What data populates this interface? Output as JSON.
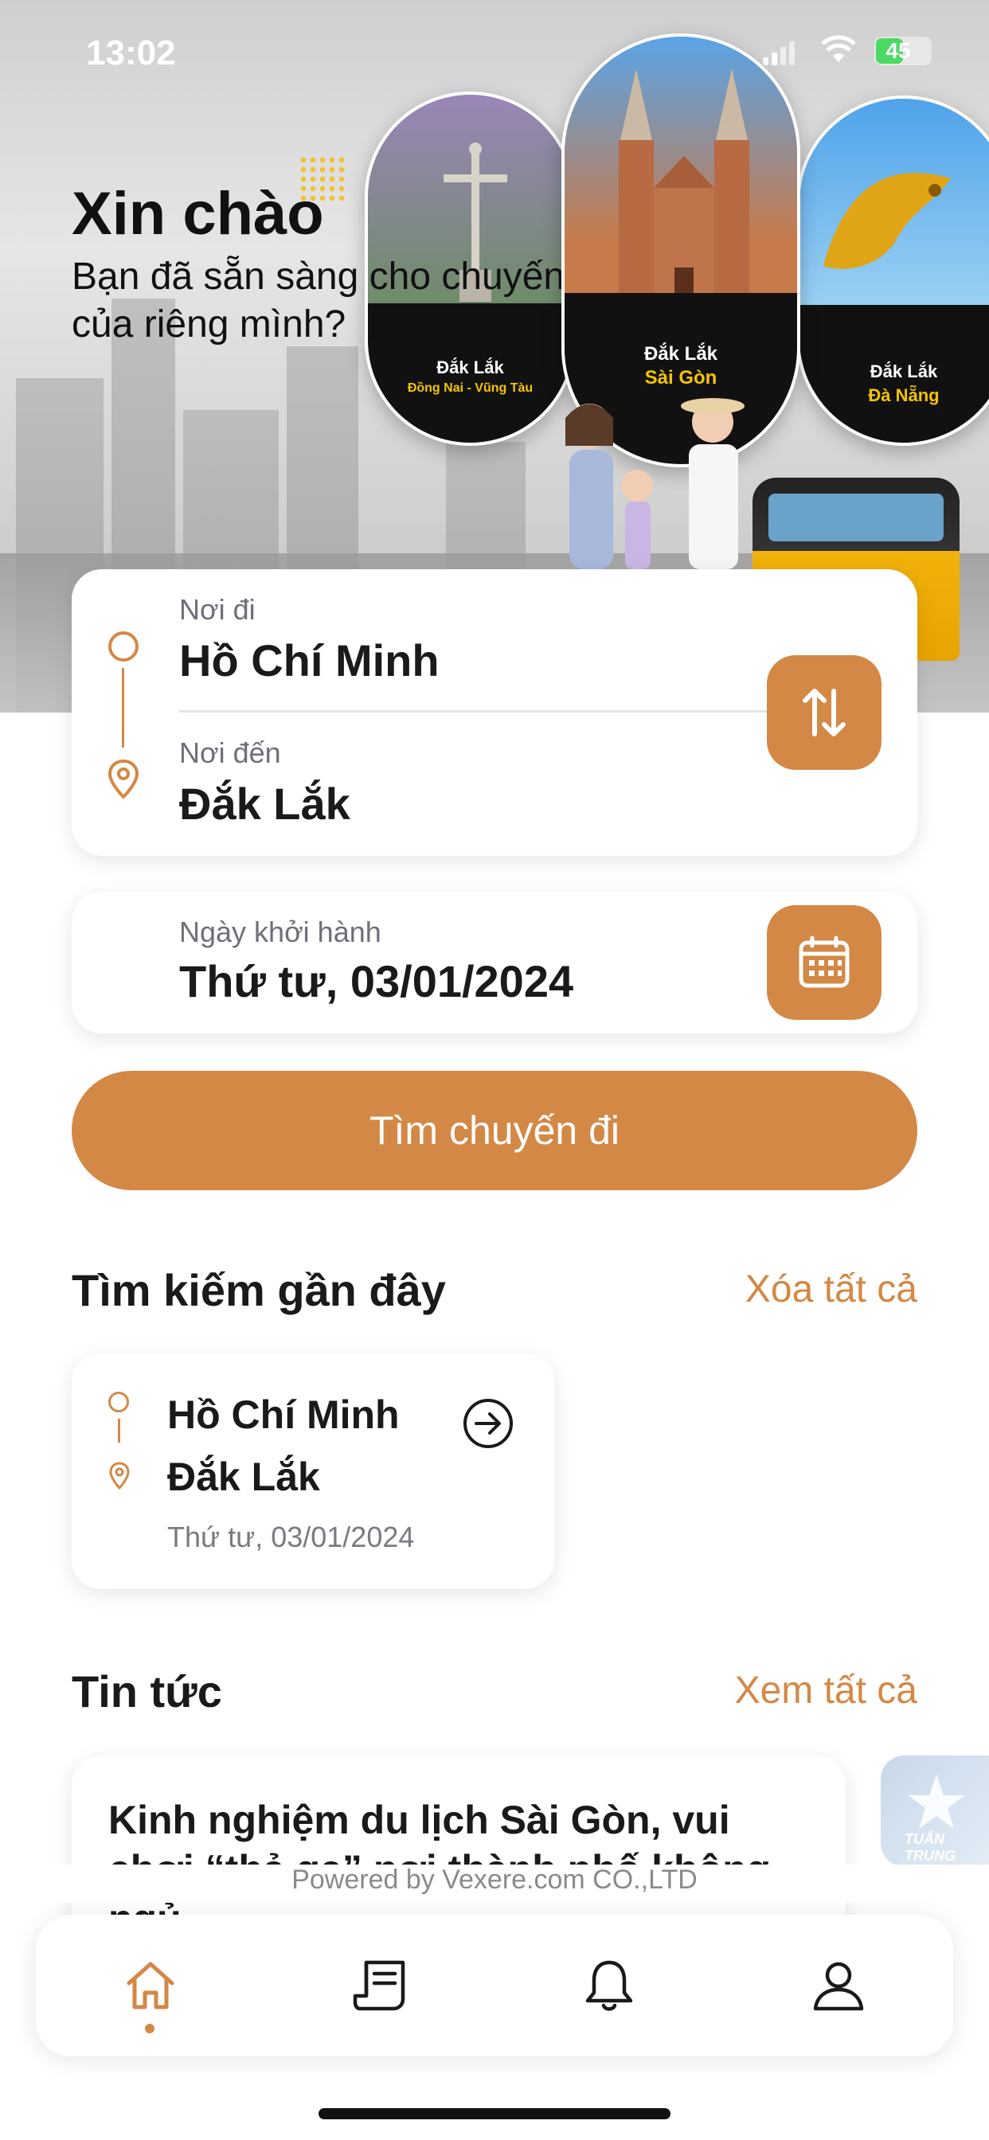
{
  "status_bar": {
    "time": "13:02",
    "battery": "45"
  },
  "hero": {
    "greeting": "Xin chào",
    "subtitle": "Bạn đã sẵn sàng cho chuyến hành trình của riêng mình?",
    "destinations": [
      {
        "from": "Đắk Lắk",
        "to": "Đồng Nai - Vũng Tàu"
      },
      {
        "from": "Đắk Lắk",
        "to": "Sài Gòn"
      },
      {
        "from": "Đắk Lắk",
        "to": "Đà Nẵng"
      }
    ]
  },
  "search": {
    "from_label": "Nơi đi",
    "from_value": "Hồ Chí Minh",
    "to_label": "Nơi đến",
    "to_value": "Đắk Lắk",
    "date_label": "Ngày khởi hành",
    "date_value": "Thứ tư, 03/01/2024",
    "submit_label": "Tìm chuyến đi"
  },
  "recent": {
    "title": "Tìm kiếm gần đây",
    "clear_label": "Xóa tất cả",
    "items": [
      {
        "from": "Hồ Chí Minh",
        "to": "Đắk Lắk",
        "date": "Thứ tư, 03/01/2024"
      }
    ]
  },
  "news": {
    "title": "Tin tức",
    "view_all_label": "Xem tất cả",
    "items": [
      {
        "title": "Kinh nghiệm du lịch Sài Gòn, vui chơi “thả ga” nơi thành phố không ngủ"
      },
      {
        "brand": "TUẤN TRUNG"
      }
    ]
  },
  "footer": {
    "powered_by": "Powered by Vexere.com CO.,LTD"
  },
  "tabbar": {
    "active": "home",
    "tabs": [
      "home-icon",
      "tickets-icon",
      "bell-icon",
      "profile-icon"
    ]
  },
  "colors": {
    "accent": "#d38845",
    "text": "#1a1a1a",
    "muted": "#6f6f7a"
  }
}
